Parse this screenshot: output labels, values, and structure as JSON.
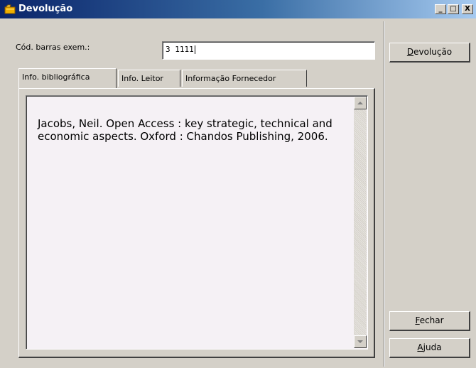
{
  "window": {
    "title": "Devolução",
    "icon": "folder-app-icon",
    "controls": {
      "minimize": "_",
      "maximize": "□",
      "close": "X"
    }
  },
  "form": {
    "barcode_label": "Cód. barras exem.:",
    "barcode_value": "3 1111"
  },
  "tabs": [
    {
      "label": "Info. bibliográfica",
      "active": true
    },
    {
      "label": "Info. Leitor",
      "active": false
    },
    {
      "label": "Informação Fornecedor",
      "active": false
    }
  ],
  "memo": {
    "text": "Jacobs, Neil. Open Access : key strategic, technical and economic aspects. Oxford : Chandos Publishing, 2006."
  },
  "buttons": {
    "devolucao": {
      "accel": "D",
      "rest": "evolução"
    },
    "fechar": {
      "accel": "F",
      "rest": "echar"
    },
    "ajuda": {
      "accel": "A",
      "rest": "juda"
    }
  }
}
